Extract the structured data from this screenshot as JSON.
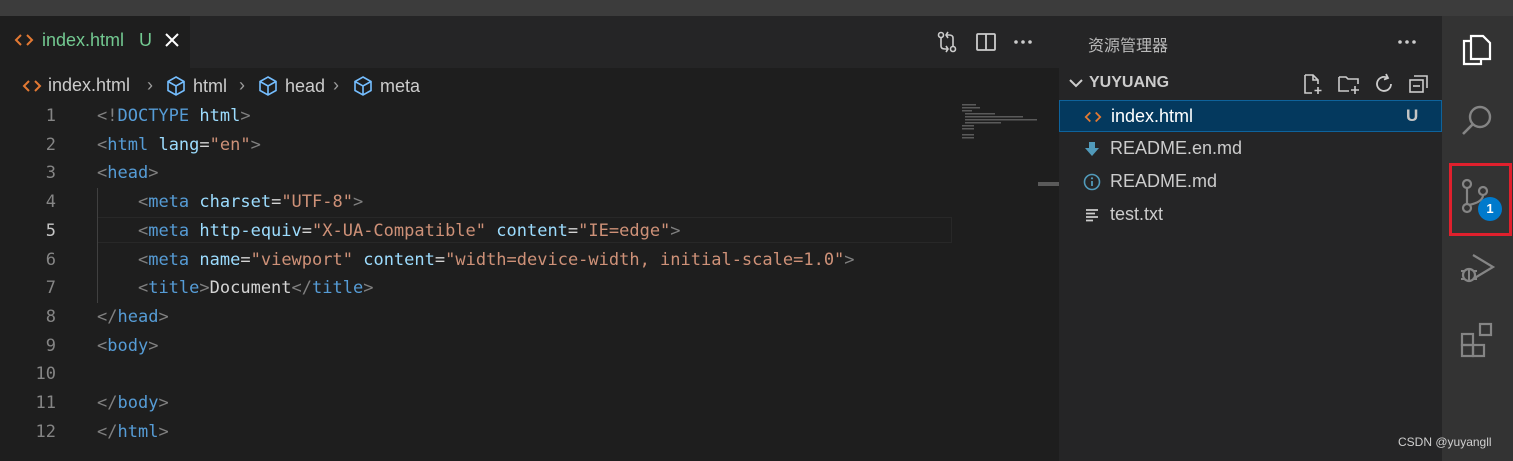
{
  "tab": {
    "filename": "index.html",
    "status": "U"
  },
  "breadcrumb": [
    "index.html",
    "html",
    "head",
    "meta"
  ],
  "code": {
    "active_line": 5,
    "lines": [
      {
        "n": "1",
        "tokens": [
          [
            "p",
            "<!"
          ],
          [
            "t",
            "DOCTYPE"
          ],
          [
            "x",
            " "
          ],
          [
            "a",
            "html"
          ],
          [
            "p",
            ">"
          ]
        ]
      },
      {
        "n": "2",
        "tokens": [
          [
            "p",
            "<"
          ],
          [
            "t",
            "html"
          ],
          [
            "x",
            " "
          ],
          [
            "a",
            "lang"
          ],
          [
            "x",
            "="
          ],
          [
            "s",
            "\"en\""
          ],
          [
            "p",
            ">"
          ]
        ]
      },
      {
        "n": "3",
        "tokens": [
          [
            "p",
            "<"
          ],
          [
            "t",
            "head"
          ],
          [
            "p",
            ">"
          ]
        ]
      },
      {
        "n": "4",
        "tokens": [
          [
            "x",
            "    "
          ],
          [
            "p",
            "<"
          ],
          [
            "t",
            "meta"
          ],
          [
            "x",
            " "
          ],
          [
            "a",
            "charset"
          ],
          [
            "x",
            "="
          ],
          [
            "s",
            "\"UTF-8\""
          ],
          [
            "p",
            ">"
          ]
        ]
      },
      {
        "n": "5",
        "tokens": [
          [
            "x",
            "    "
          ],
          [
            "p",
            "<"
          ],
          [
            "t",
            "meta"
          ],
          [
            "x",
            " "
          ],
          [
            "a",
            "http-equiv"
          ],
          [
            "x",
            "="
          ],
          [
            "s",
            "\"X-UA-Compatible\""
          ],
          [
            "x",
            " "
          ],
          [
            "a",
            "content"
          ],
          [
            "x",
            "="
          ],
          [
            "s",
            "\"IE=edge\""
          ],
          [
            "p",
            ">"
          ]
        ]
      },
      {
        "n": "6",
        "tokens": [
          [
            "x",
            "    "
          ],
          [
            "p",
            "<"
          ],
          [
            "t",
            "meta"
          ],
          [
            "x",
            " "
          ],
          [
            "a",
            "name"
          ],
          [
            "x",
            "="
          ],
          [
            "s",
            "\"viewport\""
          ],
          [
            "x",
            " "
          ],
          [
            "a",
            "content"
          ],
          [
            "x",
            "="
          ],
          [
            "s",
            "\"width=device-width, initial-scale=1.0\""
          ],
          [
            "p",
            ">"
          ]
        ]
      },
      {
        "n": "7",
        "tokens": [
          [
            "x",
            "    "
          ],
          [
            "p",
            "<"
          ],
          [
            "t",
            "title"
          ],
          [
            "p",
            ">"
          ],
          [
            "x",
            "Document"
          ],
          [
            "p",
            "</"
          ],
          [
            "t",
            "title"
          ],
          [
            "p",
            ">"
          ]
        ]
      },
      {
        "n": "8",
        "tokens": [
          [
            "p",
            "</"
          ],
          [
            "t",
            "head"
          ],
          [
            "p",
            ">"
          ]
        ]
      },
      {
        "n": "9",
        "tokens": [
          [
            "p",
            "<"
          ],
          [
            "t",
            "body"
          ],
          [
            "p",
            ">"
          ]
        ]
      },
      {
        "n": "10",
        "tokens": []
      },
      {
        "n": "11",
        "tokens": [
          [
            "p",
            "</"
          ],
          [
            "t",
            "body"
          ],
          [
            "p",
            ">"
          ]
        ]
      },
      {
        "n": "12",
        "tokens": [
          [
            "p",
            "</"
          ],
          [
            "t",
            "html"
          ],
          [
            "p",
            ">"
          ]
        ]
      }
    ]
  },
  "explorer": {
    "title": "资源管理器",
    "folder": "YUYUANG",
    "files": [
      {
        "name": "index.html",
        "icon": "html-file-icon",
        "status": "U",
        "selected": true
      },
      {
        "name": "README.en.md",
        "icon": "markdown-down-icon",
        "status": "",
        "selected": false
      },
      {
        "name": "README.md",
        "icon": "info-icon",
        "status": "",
        "selected": false
      },
      {
        "name": "test.txt",
        "icon": "text-file-icon",
        "status": "",
        "selected": false
      }
    ]
  },
  "activity_bar": {
    "items": [
      "explorer-icon",
      "search-icon",
      "source-control-icon",
      "run-debug-icon",
      "extensions-icon"
    ],
    "source_control_badge": "1"
  },
  "watermark": "CSDN @yuyangll",
  "colors": {
    "accent": "#007acc",
    "highlight_box": "#e0202d",
    "untracked": "#73c991"
  }
}
